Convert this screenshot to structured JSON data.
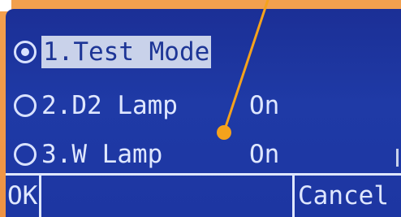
{
  "menu": {
    "items": [
      {
        "label": "1.Test Mode",
        "value": "",
        "selected": true
      },
      {
        "label": "2.D2 Lamp",
        "value": "On",
        "selected": false
      },
      {
        "label": "3.W Lamp",
        "value": "On",
        "selected": false
      }
    ]
  },
  "softkeys": {
    "ok_label": "OK",
    "cancel_label": "Cancel"
  },
  "colors": {
    "bezel": "#f09a48",
    "lcd_background": "#1f3aa6",
    "lcd_text": "#dfe7ff",
    "callout": "#f5a21c"
  }
}
